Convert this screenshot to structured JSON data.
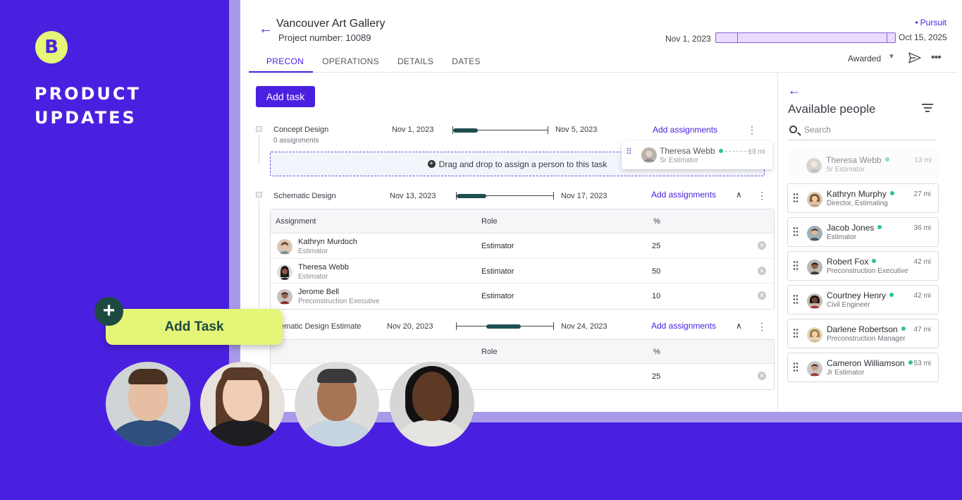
{
  "promo": {
    "logo_letter": "B",
    "title_line1": "PRODUCT",
    "title_line2": "UPDATES",
    "add_task_label": "Add Task",
    "plus": "+"
  },
  "header": {
    "project_title": "Vancouver Art Gallery",
    "project_number": "Project number: 10089",
    "status_tag": "Pursuit",
    "timeline_start": "Nov 1, 2023",
    "timeline_end": "Oct 15, 2025",
    "stage_select": "Awarded"
  },
  "tabs": [
    {
      "label": "PRECON",
      "active": true
    },
    {
      "label": "OPERATIONS",
      "active": false
    },
    {
      "label": "DETAILS",
      "active": false
    },
    {
      "label": "DATES",
      "active": false
    }
  ],
  "add_task_button": "Add task",
  "tasks": [
    {
      "name": "Concept Design",
      "sub": "0 assignments",
      "start": "Nov 1, 2023",
      "end": "Nov 5, 2023",
      "add_label": "Add assignments",
      "progress": 0.26
    },
    {
      "name": "Schematic Design",
      "sub": "",
      "start": "Nov 13, 2023",
      "end": "Nov 17, 2023",
      "add_label": "Add assignments",
      "progress": 0.3
    },
    {
      "name": "ematic Design Estimate",
      "sub": "",
      "start": "Nov 20, 2023",
      "end": "Nov 24, 2023",
      "add_label": "Add assignments",
      "progress": 0.35
    }
  ],
  "dropzone": {
    "icon": "+",
    "label": "Drag and drop to assign a person to this task"
  },
  "dragging_card": {
    "name": "Theresa Webb",
    "role": "Sr Estimator",
    "distance": "13 mi"
  },
  "assignment_table": {
    "headers": {
      "assignment": "Assignment",
      "role": "Role",
      "pct": "%"
    },
    "rows": [
      {
        "name": "Kathryn Murdoch",
        "title": "Estimator",
        "role": "Estimator",
        "pct": "25"
      },
      {
        "name": "Theresa Webb",
        "title": "Estimator",
        "role": "Estimator",
        "pct": "50"
      },
      {
        "name": "Jerome Bell",
        "title": "Preconstruction Executive",
        "role": "Estimator",
        "pct": "10"
      }
    ]
  },
  "assignment_table_2": {
    "headers": {
      "role": "Role",
      "pct": "%"
    },
    "rows": [
      {
        "pct": "25"
      }
    ]
  },
  "side_panel": {
    "title": "Available people",
    "search_placeholder": "Search",
    "ghost": {
      "name": "Theresa Webb",
      "role": "Sr Estimator",
      "distance": "13 mi"
    },
    "people": [
      {
        "name": "Kathryn Murphy",
        "role": "Director, Estimating",
        "distance": "27 mi"
      },
      {
        "name": "Jacob Jones",
        "role": "Estimator",
        "distance": "36 mi"
      },
      {
        "name": "Robert Fox",
        "role": "Preconstruction Executive",
        "distance": "42 mi"
      },
      {
        "name": "Courtney Henry",
        "role": "Civil Engineer",
        "distance": "42 mi"
      },
      {
        "name": "Darlene Robertson",
        "role": "Preconstruction Manager",
        "distance": "47 mi"
      },
      {
        "name": "Cameron Williamson",
        "role": "Jr Estimator",
        "distance": "53 mi"
      }
    ]
  },
  "colors": {
    "brand_purple": "#4a20e0",
    "accent_lime": "#e4f578",
    "dark_teal": "#1d4a40",
    "online_green": "#2ec38a"
  }
}
